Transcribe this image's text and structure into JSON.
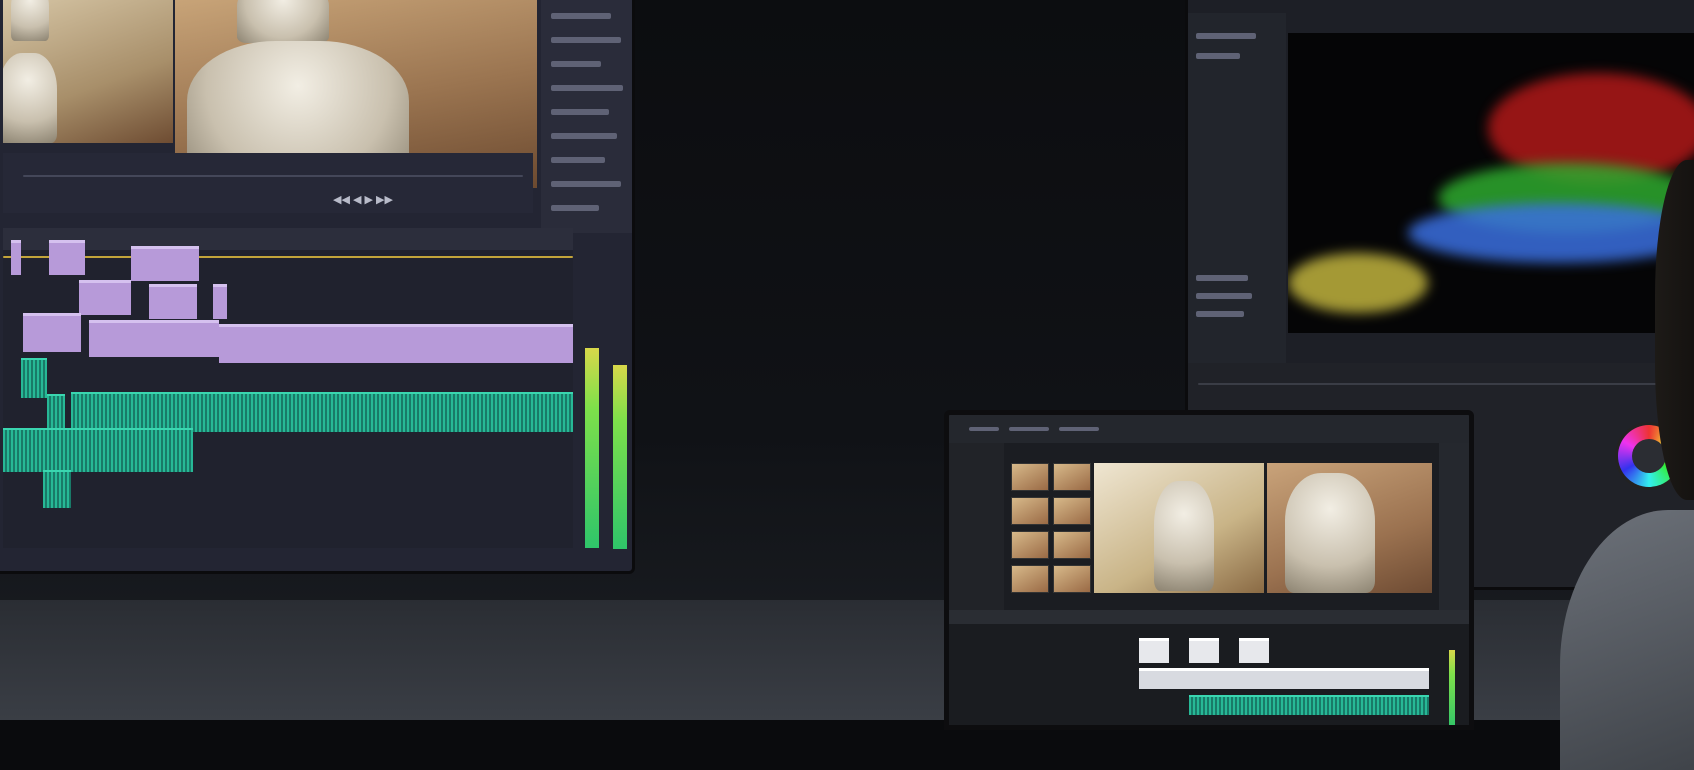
{
  "scene": {
    "description_tags": [
      "video-edit-suite",
      "color-grading"
    ],
    "colors": {
      "video_clip": "#b79ad9",
      "audio_clip": "#1d8f7a",
      "meter": "#2fc56a",
      "scope_bg": "#050506"
    }
  },
  "left_monitor": {
    "icons": [
      "play-icon",
      "step-back-icon",
      "step-forward-icon"
    ]
  },
  "right_monitor": {
    "icons": [
      "color-wheel-icon"
    ]
  },
  "front_monitor": {
    "icons": [
      "folder-icon",
      "play-icon"
    ]
  }
}
